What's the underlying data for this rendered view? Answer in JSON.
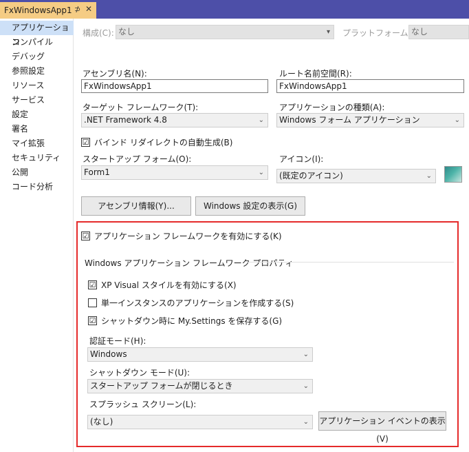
{
  "tab": {
    "title": "FxWindowsApp1",
    "pin": "⊅",
    "close": "✕"
  },
  "sidebar": {
    "items": [
      {
        "label": "アプリケーション"
      },
      {
        "label": "コンパイル"
      },
      {
        "label": "デバッグ"
      },
      {
        "label": "参照設定"
      },
      {
        "label": "リソース"
      },
      {
        "label": "サービス"
      },
      {
        "label": "設定"
      },
      {
        "label": "署名"
      },
      {
        "label": "マイ拡張"
      },
      {
        "label": "セキュリティ"
      },
      {
        "label": "公開"
      },
      {
        "label": "コード分析"
      }
    ]
  },
  "toolbar": {
    "config_label": "構成(C):",
    "config_value": "なし",
    "platform_label": "プラットフォーム(M):",
    "platform_value": "なし"
  },
  "form": {
    "assembly_name_label": "アセンブリ名(N):",
    "assembly_name_value": "FxWindowsApp1",
    "root_namespace_label": "ルート名前空間(R):",
    "root_namespace_value": "FxWindowsApp1",
    "target_framework_label": "ターゲット フレームワーク(T):",
    "target_framework_value": ".NET Framework 4.8",
    "app_type_label": "アプリケーションの種類(A):",
    "app_type_value": "Windows フォーム アプリケーション",
    "auto_binding_label": "バインド リダイレクトの自動生成(B)",
    "startup_form_label": "スタートアップ フォーム(O):",
    "startup_form_value": "Form1",
    "icon_label": "アイコン(I):",
    "icon_value": "(既定のアイコン)",
    "assembly_info_button": "アセンブリ情報(Y)...",
    "windows_settings_button": "Windows 設定の表示(G)"
  },
  "framework": {
    "enable_label": "アプリケーション フレームワークを有効にする(K)",
    "section_title": "Windows アプリケーション フレームワーク プロパティ",
    "xp_visual_label": "XP Visual スタイルを有効にする(X)",
    "single_instance_label": "単一インスタンスのアプリケーションを作成する(S)",
    "save_settings_label": "シャットダウン時に My.Settings を保存する(G)",
    "auth_mode_label": "認証モード(H):",
    "auth_mode_value": "Windows",
    "shutdown_mode_label": "シャットダウン モード(U):",
    "shutdown_mode_value": "スタートアップ フォームが閉じるとき",
    "splash_label": "スプラッシュ スクリーン(L):",
    "splash_value": "(なし)",
    "app_events_button": "アプリケーション イベントの表示(V)"
  },
  "checks": {
    "auto_binding": "☑",
    "enable_framework": "☑",
    "xp_visual": "☑",
    "single_instance": "",
    "save_settings": "☑"
  },
  "colors": {
    "highlight_border": "#e52a2a",
    "tab_active": "#f5cc84",
    "tabstrip": "#4d4fa8",
    "selected_nav": "#cde0f7"
  }
}
